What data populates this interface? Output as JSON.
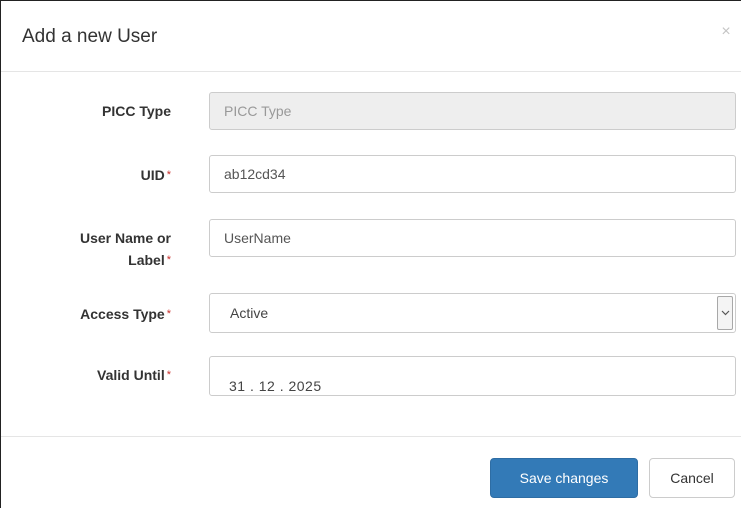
{
  "modal": {
    "title": "Add a new User",
    "close_symbol": "×"
  },
  "form": {
    "picc_type": {
      "label": "PICC Type",
      "placeholder": "PICC Type",
      "value": ""
    },
    "uid": {
      "label": "UID",
      "required_mark": "*",
      "value": "ab12cd34"
    },
    "user_name": {
      "label_line1": "User Name or",
      "label_line2": "Label",
      "required_mark": "*",
      "value": "UserName"
    },
    "access_type": {
      "label": "Access Type",
      "required_mark": "*",
      "selected": "Active",
      "arrow_icon": "chevron-down-icon"
    },
    "valid_until": {
      "label": "Valid Until",
      "required_mark": "*",
      "value": "31 . 12 . 2025"
    }
  },
  "footer": {
    "save_label": "Save changes",
    "cancel_label": "Cancel"
  },
  "colors": {
    "primary": "#337ab7",
    "required": "#c9302c",
    "disabled_bg": "#eeeeee"
  }
}
